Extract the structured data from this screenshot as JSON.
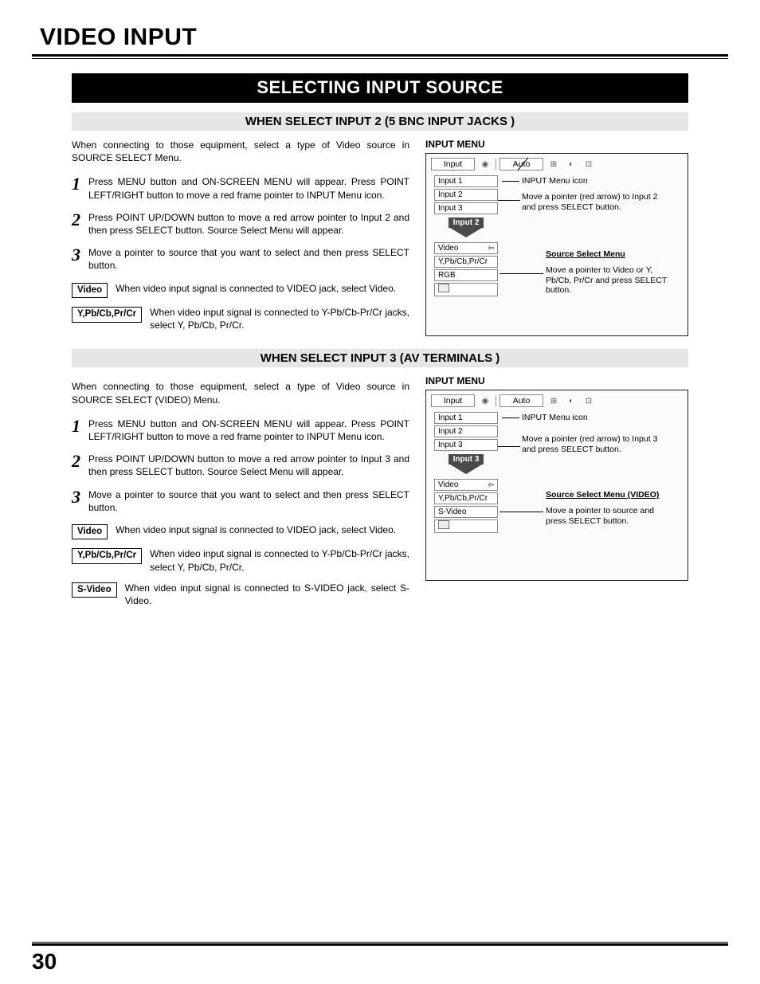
{
  "page": {
    "title": "VIDEO INPUT",
    "number": "30"
  },
  "banner": "SELECTING INPUT SOURCE",
  "sectionA": {
    "subtitle": "WHEN SELECT INPUT 2 (5 BNC INPUT JACKS )",
    "intro": "When connecting to those equipment, select a type of Video source in SOURCE SELECT Menu.",
    "steps": [
      {
        "n": "1",
        "t": "Press MENU button and ON-SCREEN MENU will appear.  Press POINT LEFT/RIGHT button to move a red frame pointer to INPUT Menu icon."
      },
      {
        "n": "2",
        "t": "Press POINT UP/DOWN button to move a red arrow pointer to Input 2 and then press SELECT button.  Source Select Menu will appear."
      },
      {
        "n": "3",
        "t": "Move a pointer to source that you want to select and then press SELECT button."
      }
    ],
    "options": [
      {
        "label": "Video",
        "t": "When video input signal is connected to VIDEO jack, select Video."
      },
      {
        "label": "Y,Pb/Cb,Pr/Cr",
        "t": "When video input signal is connected to Y-Pb/Cb-Pr/Cr jacks, select Y, Pb/Cb, Pr/Cr."
      }
    ],
    "menu": {
      "heading": "INPUT MENU",
      "topLabel": "Input",
      "topRight": "Auto",
      "items": [
        "Input 1",
        "Input 2",
        "Input 3"
      ],
      "arrowLabel": "Input 2",
      "sourceTitle": "Source Select Menu",
      "sourceItems": [
        "Video",
        "Y,Pb/Cb,Pr/Cr",
        "RGB"
      ],
      "annot1": "INPUT Menu icon",
      "annot2": "Move a pointer (red arrow) to Input 2 and press SELECT button.",
      "annot3": "Move a pointer to Video or Y, Pb/Cb, Pr/Cr and press SELECT button."
    }
  },
  "sectionB": {
    "subtitle": "WHEN SELECT INPUT 3 (AV TERMINALS )",
    "intro": "When connecting to those equipment, select a type of Video source in SOURCE SELECT (VIDEO) Menu.",
    "steps": [
      {
        "n": "1",
        "t": "Press MENU button and ON-SCREEN MENU will appear.  Press POINT LEFT/RIGHT button to move a red frame pointer to INPUT Menu icon."
      },
      {
        "n": "2",
        "t": "Press POINT UP/DOWN button to move a red arrow pointer to Input 3 and then press SELECT button.  Source Select Menu will appear."
      },
      {
        "n": "3",
        "t": "Move a pointer to source that you want to select and then press SELECT button."
      }
    ],
    "options": [
      {
        "label": "Video",
        "t": "When video input signal is connected to VIDEO jack, select Video."
      },
      {
        "label": "Y,Pb/Cb,Pr/Cr",
        "t": "When video input signal is connected to Y-Pb/Cb-Pr/Cr jacks, select Y, Pb/Cb, Pr/Cr."
      },
      {
        "label": "S-Video",
        "t": "When video input signal is connected to S-VIDEO jack, select S-Video."
      }
    ],
    "menu": {
      "heading": "INPUT MENU",
      "topLabel": "Input",
      "topRight": "Auto",
      "items": [
        "Input 1",
        "Input 2",
        "Input 3"
      ],
      "arrowLabel": "Input 3",
      "sourceTitle": "Source Select Menu (VIDEO)",
      "sourceItems": [
        "Video",
        "Y,Pb/Cb,Pr/Cr",
        "S-Video"
      ],
      "annot1": "INPUT Menu icon",
      "annot2": "Move a pointer (red arrow) to Input 3 and press SELECT button.",
      "annot3": "Move a pointer to source and press SELECT button."
    }
  }
}
